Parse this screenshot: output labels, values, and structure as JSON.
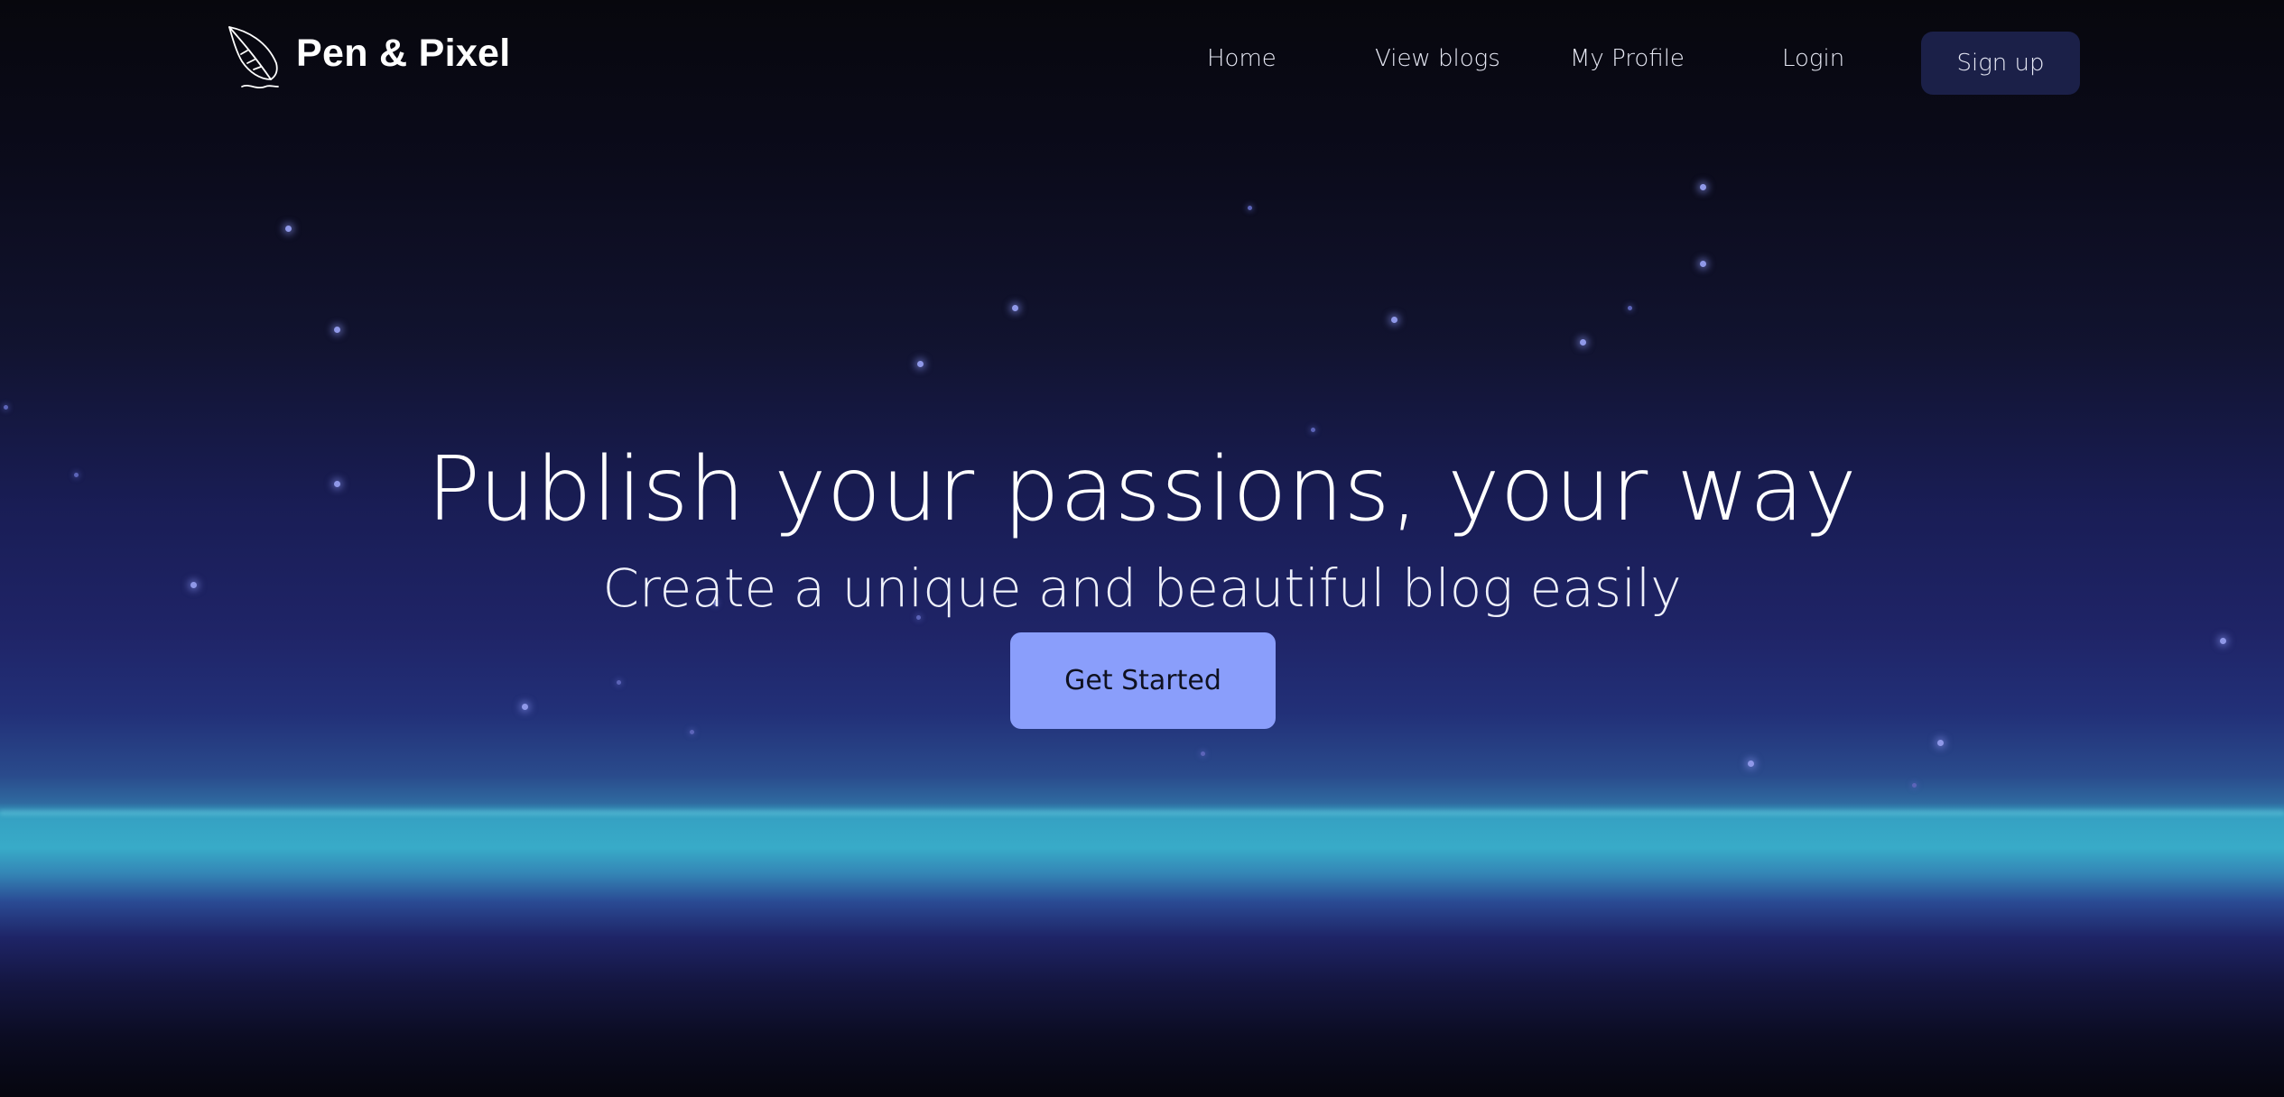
{
  "header": {
    "brand_name": "Pen & Pixel",
    "logo_icon": "feather-quill-icon",
    "nav": {
      "home": "Home",
      "view_blogs": "View blogs",
      "my_profile": "My Profile",
      "login": "Login",
      "signup": "Sign up"
    }
  },
  "hero": {
    "title": "Publish your passions, your way",
    "subtitle": "Create a unique and beautiful blog easily",
    "cta_label": "Get Started"
  },
  "colors": {
    "cta_background": "#8a9efb",
    "signup_background": "#1b2048",
    "horizon": "#38abc8",
    "sky_dark": "#07070d",
    "sky_indigo": "#1f2467"
  }
}
